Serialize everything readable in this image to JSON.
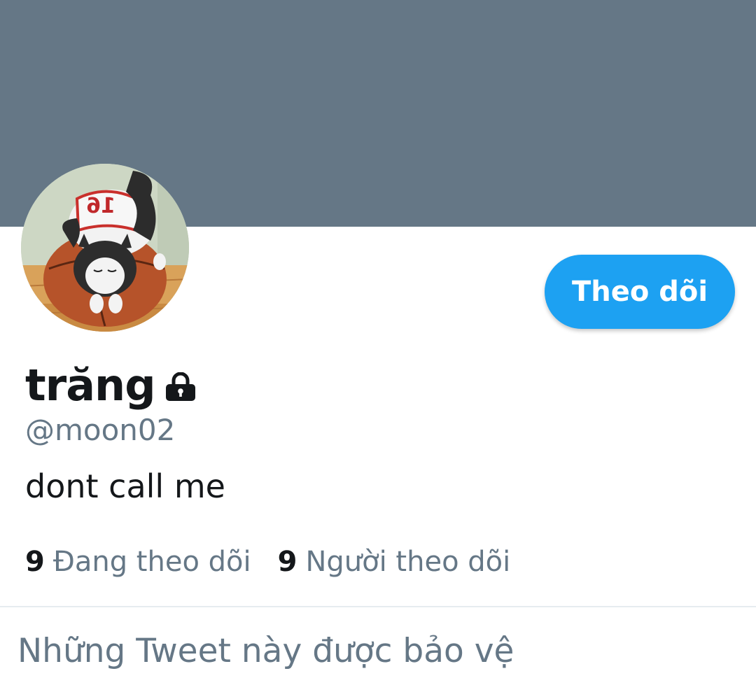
{
  "profile": {
    "display_name": "trăng",
    "handle": "@moon02",
    "bio": "dont call me",
    "avatar_jersey_number": "16",
    "protected": true
  },
  "actions": {
    "follow_label": "Theo dõi"
  },
  "stats": {
    "following_count": "9",
    "following_label": "Đang theo dõi",
    "followers_count": "9",
    "followers_label": "Người theo dõi"
  },
  "timeline": {
    "protected_message": "Những Tweet này được bảo vệ"
  },
  "colors": {
    "banner": "#657786",
    "accent": "#1da1f2",
    "secondary_text": "#657786",
    "primary_text": "#14171a"
  },
  "icons": {
    "lock": "lock-icon"
  }
}
